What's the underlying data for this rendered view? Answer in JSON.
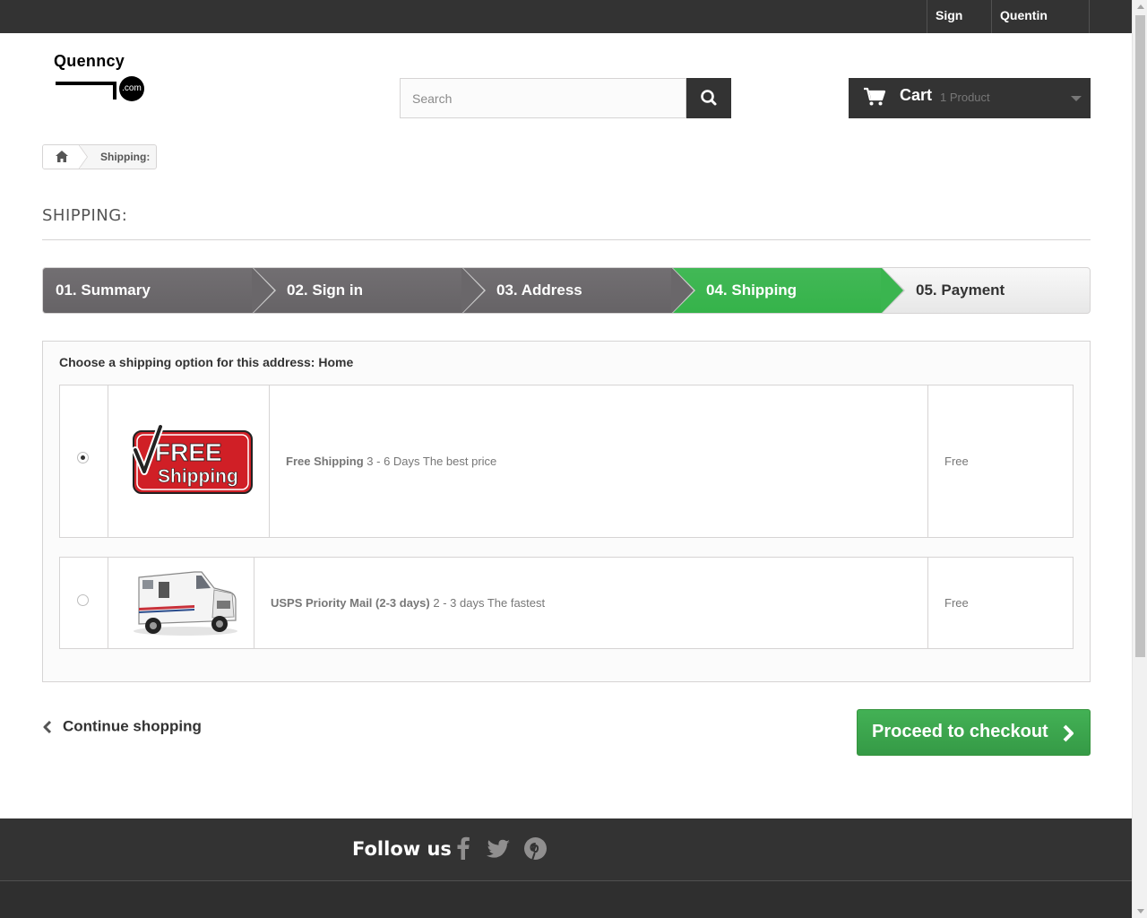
{
  "header": {
    "sign_out": "Sign out",
    "user_name": "Quentin Crabb"
  },
  "logo": {
    "name": "Quenncy",
    "badge": ".com"
  },
  "search": {
    "placeholder": "Search"
  },
  "cart": {
    "label": "Cart",
    "count": "1 Product"
  },
  "breadcrumb": {
    "current": "Shipping:"
  },
  "page": {
    "heading": "SHIPPING:"
  },
  "steps": [
    {
      "label": "01. Summary",
      "state": "done"
    },
    {
      "label": "02. Sign in",
      "state": "done"
    },
    {
      "label": "03. Address",
      "state": "done"
    },
    {
      "label": "04. Shipping",
      "state": "current"
    },
    {
      "label": "05. Payment",
      "state": "todo"
    }
  ],
  "delivery": {
    "title": "Choose a shipping option for this address: Home",
    "options": [
      {
        "selected": true,
        "name": "Free Shipping",
        "detail": "3 - 6 Days The best price",
        "price": "Free",
        "logo_top": "FREE",
        "logo_bottom": "Shipping"
      },
      {
        "selected": false,
        "name": "USPS Priority Mail (2-3 days)",
        "detail": "2 - 3 days The fastest",
        "price": "Free"
      }
    ]
  },
  "actions": {
    "continue": "Continue shopping",
    "checkout": "Proceed to checkout"
  },
  "footer": {
    "follow_us": "Follow us",
    "social_icons": [
      "facebook-icon",
      "twitter-icon",
      "pinterest-icon"
    ]
  },
  "colors": {
    "dark": "#333333",
    "accent_green": "#3ab54f",
    "step_done": "#6a676a"
  }
}
